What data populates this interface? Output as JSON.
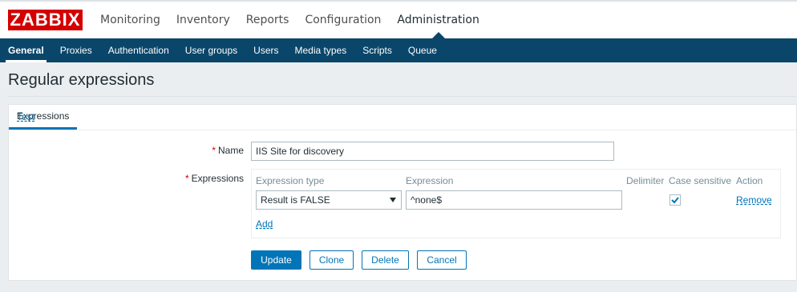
{
  "brand": {
    "logo_text": "ZABBIX",
    "logo_color": "#d40000"
  },
  "main_menu": {
    "items": [
      {
        "label": "Monitoring"
      },
      {
        "label": "Inventory"
      },
      {
        "label": "Reports"
      },
      {
        "label": "Configuration"
      },
      {
        "label": "Administration",
        "active": true
      }
    ]
  },
  "sub_menu": {
    "items": [
      {
        "label": "General",
        "active": true
      },
      {
        "label": "Proxies"
      },
      {
        "label": "Authentication"
      },
      {
        "label": "User groups"
      },
      {
        "label": "Users"
      },
      {
        "label": "Media types"
      },
      {
        "label": "Scripts"
      },
      {
        "label": "Queue"
      }
    ]
  },
  "page": {
    "title": "Regular expressions"
  },
  "tabs": [
    {
      "label": "Expressions",
      "active": true
    },
    {
      "label": "Test"
    }
  ],
  "form": {
    "name_label": "Name",
    "name_value": "IIS Site for discovery",
    "expressions_label": "Expressions",
    "required_mark": "*",
    "table": {
      "headers": {
        "expression_type": "Expression type",
        "expression": "Expression",
        "delimiter": "Delimiter",
        "case_sensitive": "Case sensitive",
        "action": "Action"
      },
      "rows": [
        {
          "expression_type": "Result is FALSE",
          "expression": "^none$",
          "case_sensitive": true,
          "action": "Remove"
        }
      ],
      "add_label": "Add"
    }
  },
  "buttons": {
    "update": "Update",
    "clone": "Clone",
    "delete": "Delete",
    "cancel": "Cancel"
  },
  "colors": {
    "nav_background": "#0a466a",
    "accent": "#0275b8",
    "page_background": "#ebeef0"
  }
}
